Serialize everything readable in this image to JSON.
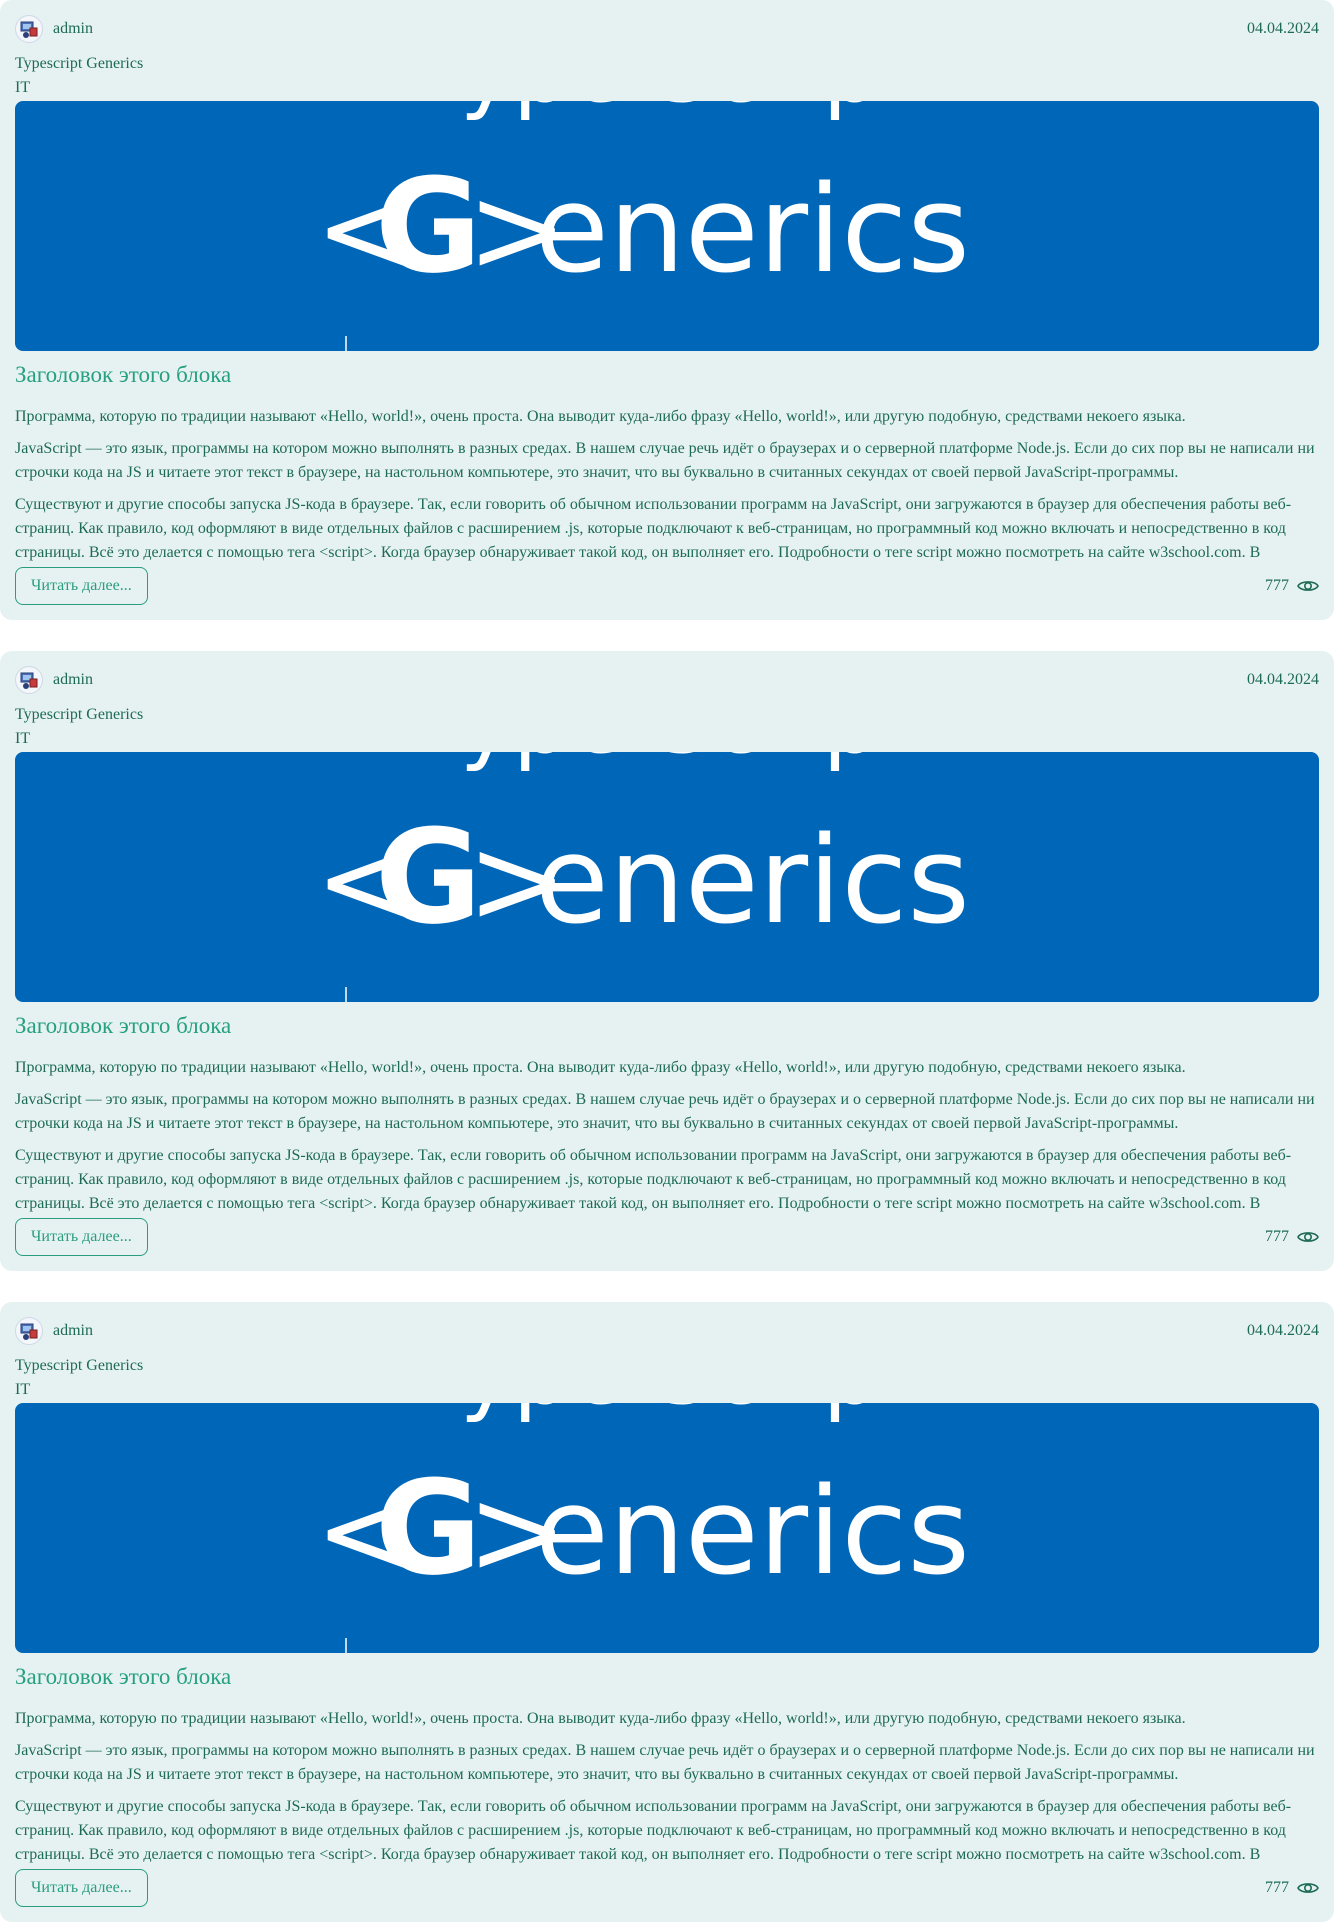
{
  "posts": [
    {
      "author": "admin",
      "date": "04.04.2024",
      "tag_lines": [
        "Typescript Generics",
        "IT"
      ],
      "banner": {
        "text_top": "Type Script",
        "text_main_left": "<",
        "text_main_g": "G",
        "text_main_right": ">",
        "text_main_rest": "enerics",
        "background": "#0066b8"
      },
      "title": "Заголовок этого блока",
      "paragraphs": [
        "Программа, которую по традиции называют «Hello, world!», очень проста. Она выводит куда-либо фразу «Hello, world!», или другую подобную, средствами некоего языка.",
        "JavaScript — это язык, программы на котором можно выполнять в разных средах. В нашем случае речь идёт о браузерах и о серверной платформе Node.js. Если до сих пор вы не написали ни строчки кода на JS и читаете этот текст в браузере, на настольном компьютере, это значит, что вы буквально в считанных секундах от своей первой JavaScript-программы.",
        "Существуют и другие способы запуска JS-кода в браузере. Так, если говорить об обычном использовании программ на JavaScript, они загружаются в браузер для обеспечения работы веб-страниц. Как правило, код оформляют в виде отдельных файлов с расширением .js, которые подключают к веб-страницам, но программный код можно включать и непосредственно в код страницы. Всё это делается с помощью тега <script>. Когда браузер обнаруживает такой код, он выполняет его. Подробности о теге script можно посмотреть на сайте w3school.com. В"
      ],
      "read_more_label": "Читать далее...",
      "views": "777",
      "icons": {
        "avatar": "user-avatar-icon",
        "views": "eye-icon"
      }
    },
    {
      "author": "admin",
      "date": "04.04.2024",
      "tag_lines": [
        "Typescript Generics",
        "IT"
      ],
      "banner": {
        "text_top": "Type Script",
        "text_main_left": "<",
        "text_main_g": "G",
        "text_main_right": ">",
        "text_main_rest": "enerics",
        "background": "#0066b8"
      },
      "title": "Заголовок этого блока",
      "paragraphs": [
        "Программа, которую по традиции называют «Hello, world!», очень проста. Она выводит куда-либо фразу «Hello, world!», или другую подобную, средствами некоего языка.",
        "JavaScript — это язык, программы на котором можно выполнять в разных средах. В нашем случае речь идёт о браузерах и о серверной платформе Node.js. Если до сих пор вы не написали ни строчки кода на JS и читаете этот текст в браузере, на настольном компьютере, это значит, что вы буквально в считанных секундах от своей первой JavaScript-программы.",
        "Существуют и другие способы запуска JS-кода в браузере. Так, если говорить об обычном использовании программ на JavaScript, они загружаются в браузер для обеспечения работы веб-страниц. Как правило, код оформляют в виде отдельных файлов с расширением .js, которые подключают к веб-страницам, но программный код можно включать и непосредственно в код страницы. Всё это делается с помощью тега <script>. Когда браузер обнаруживает такой код, он выполняет его. Подробности о теге script можно посмотреть на сайте w3school.com. В"
      ],
      "read_more_label": "Читать далее...",
      "views": "777",
      "icons": {
        "avatar": "user-avatar-icon",
        "views": "eye-icon"
      }
    },
    {
      "author": "admin",
      "date": "04.04.2024",
      "tag_lines": [
        "Typescript Generics",
        "IT"
      ],
      "banner": {
        "text_top": "Type Script",
        "text_main_left": "<",
        "text_main_g": "G",
        "text_main_right": ">",
        "text_main_rest": "enerics",
        "background": "#0066b8"
      },
      "title": "Заголовок этого блока",
      "paragraphs": [
        "Программа, которую по традиции называют «Hello, world!», очень проста. Она выводит куда-либо фразу «Hello, world!», или другую подобную, средствами некоего языка.",
        "JavaScript — это язык, программы на котором можно выполнять в разных средах. В нашем случае речь идёт о браузерах и о серверной платформе Node.js. Если до сих пор вы не написали ни строчки кода на JS и читаете этот текст в браузере, на настольном компьютере, это значит, что вы буквально в считанных секундах от своей первой JavaScript-программы.",
        "Существуют и другие способы запуска JS-кода в браузере. Так, если говорить об обычном использовании программ на JavaScript, они загружаются в браузер для обеспечения работы веб-страниц. Как правило, код оформляют в виде отдельных файлов с расширением .js, которые подключают к веб-страницам, но программный код можно включать и непосредственно в код страницы. Всё это делается с помощью тега <script>. Когда браузер обнаруживает такой код, он выполняет его. Подробности о теге script можно посмотреть на сайте w3school.com. В"
      ],
      "read_more_label": "Читать далее...",
      "views": "777",
      "icons": {
        "avatar": "user-avatar-icon",
        "views": "eye-icon"
      }
    }
  ],
  "colors": {
    "card_background": "#e6f2f1",
    "text": "#1d6b55",
    "accent": "#27a082",
    "banner": "#0066b8"
  }
}
